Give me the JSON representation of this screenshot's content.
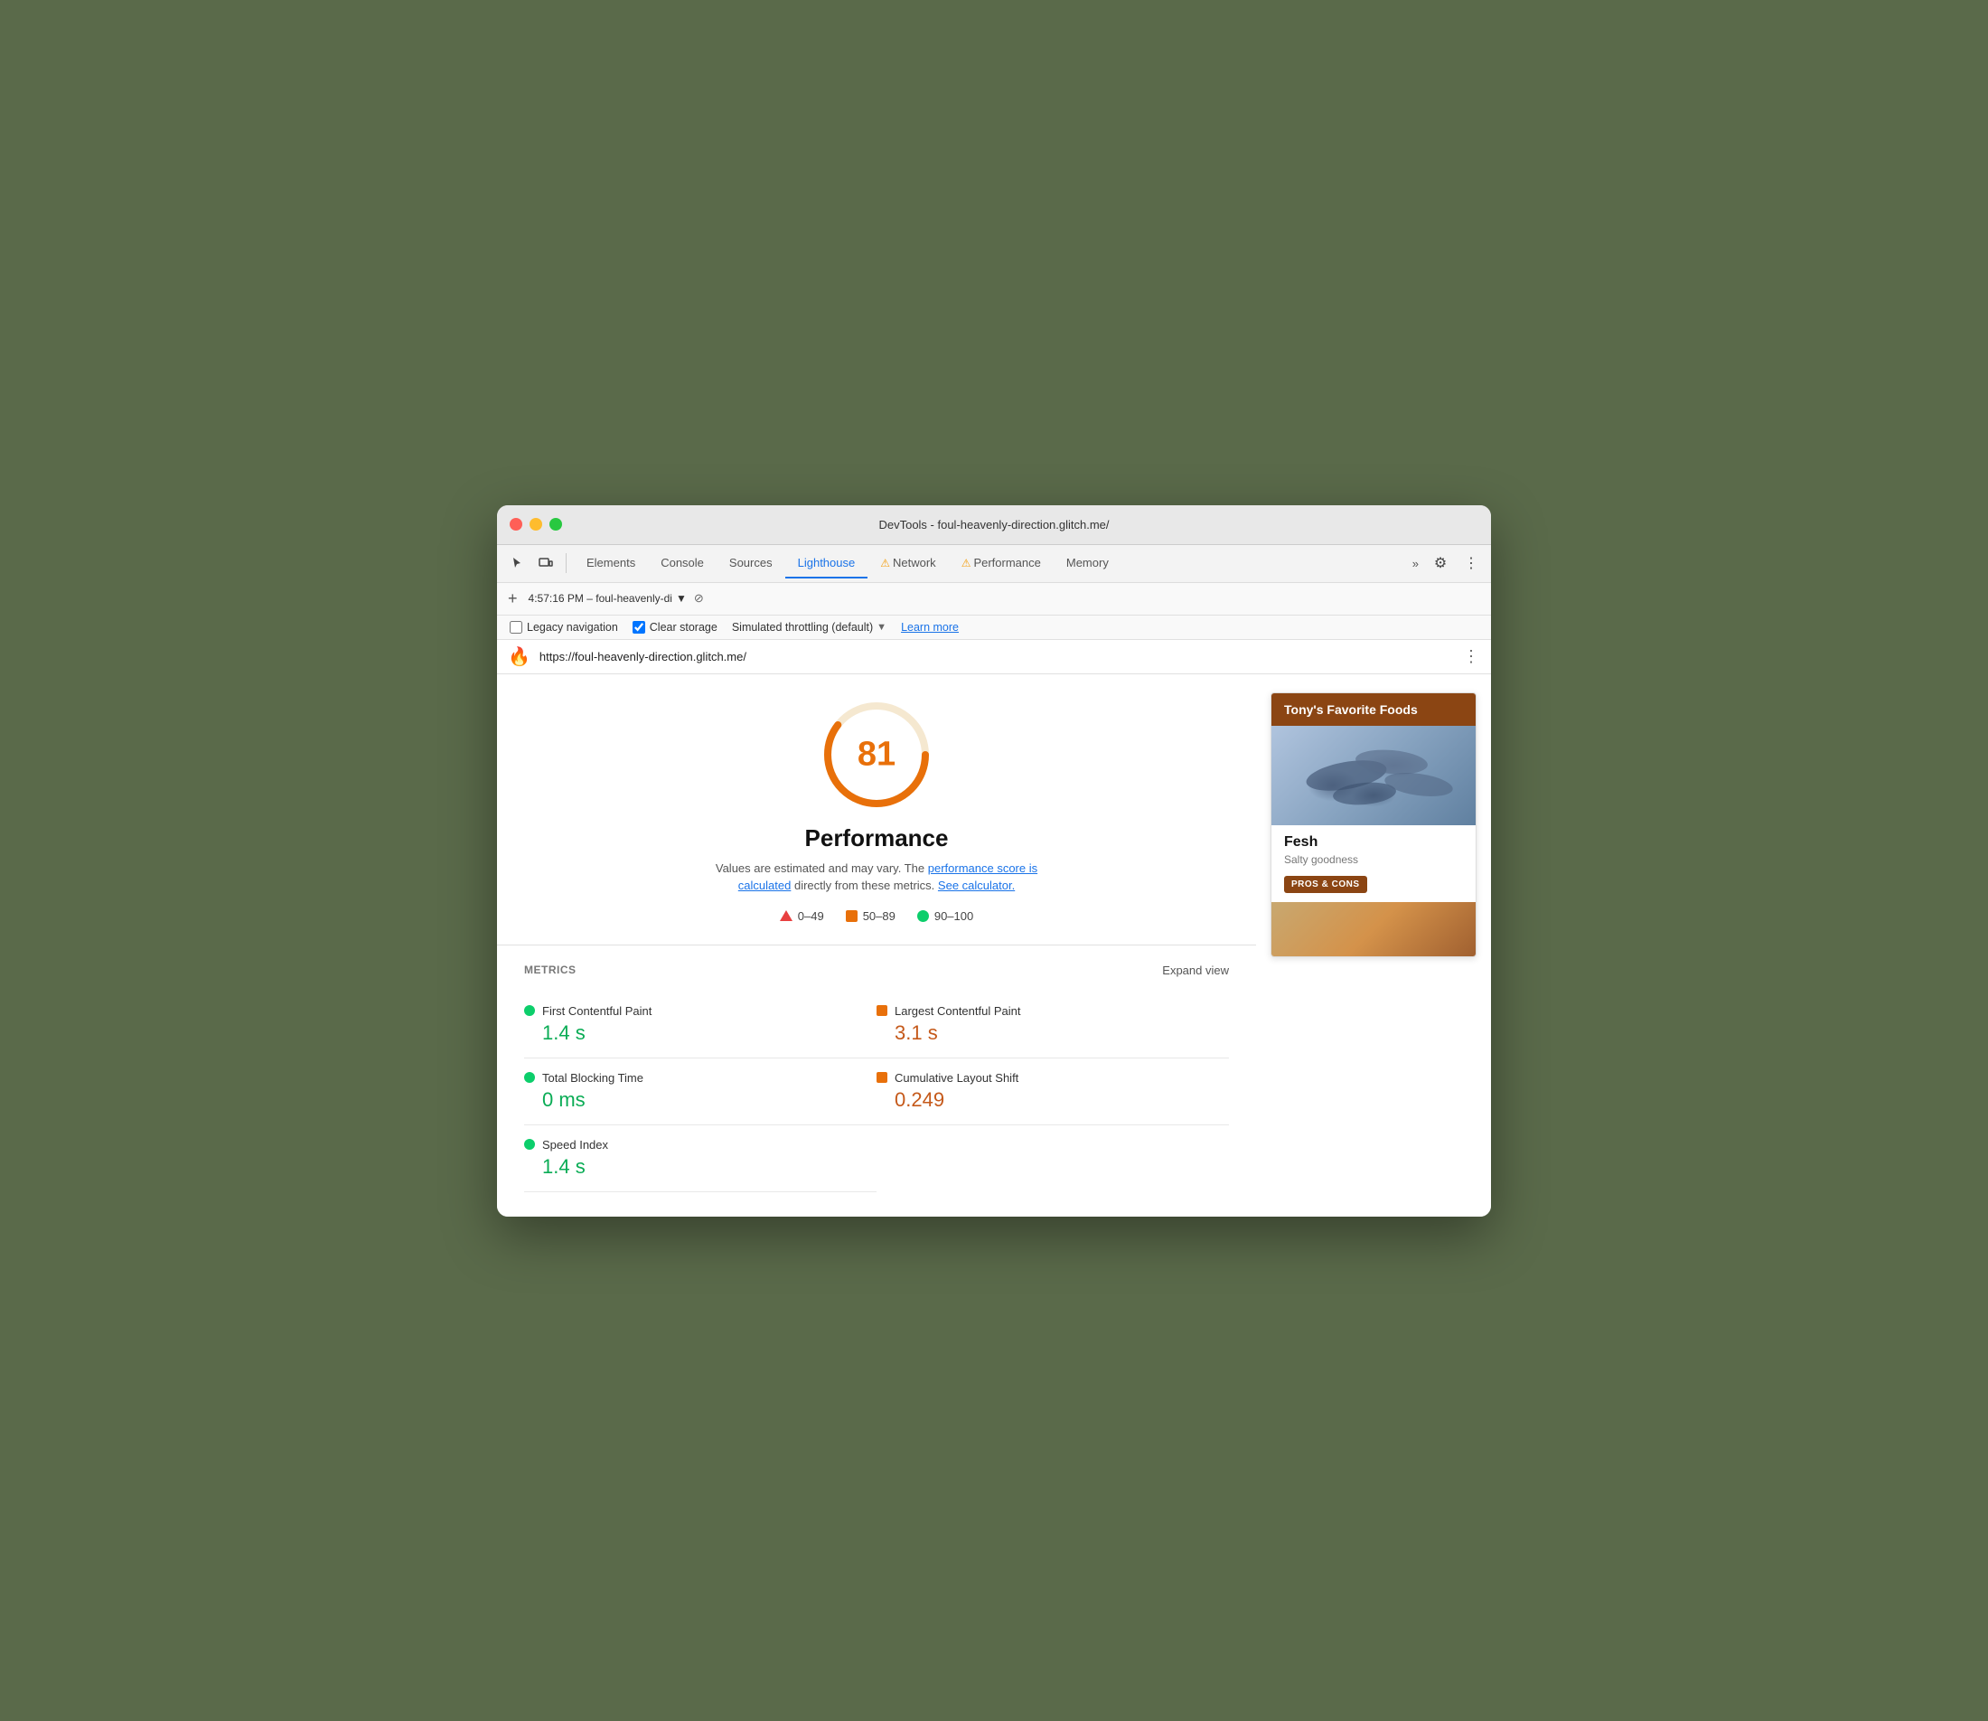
{
  "window": {
    "title": "DevTools - foul-heavenly-direction.glitch.me/"
  },
  "titlebar_buttons": {
    "close": "close",
    "minimize": "minimize",
    "maximize": "maximize"
  },
  "tabs": [
    {
      "label": "Elements",
      "active": false,
      "warning": false
    },
    {
      "label": "Console",
      "active": false,
      "warning": false
    },
    {
      "label": "Sources",
      "active": false,
      "warning": false
    },
    {
      "label": "Lighthouse",
      "active": true,
      "warning": false
    },
    {
      "label": "Network",
      "active": false,
      "warning": true
    },
    {
      "label": "Performance",
      "active": false,
      "warning": true
    },
    {
      "label": "Memory",
      "active": false,
      "warning": false
    }
  ],
  "toolbar": {
    "more_tabs": "»",
    "settings_icon": "⚙",
    "dots_icon": "⋮"
  },
  "session": {
    "label": "4:57:16 PM – foul-heavenly-di",
    "dropdown_arrow": "▼",
    "block_icon": "⊘"
  },
  "options": {
    "legacy_nav_label": "Legacy navigation",
    "legacy_nav_checked": false,
    "clear_storage_label": "Clear storage",
    "clear_storage_checked": true,
    "throttle_label": "Simulated throttling (default)",
    "throttle_arrow": "▼",
    "learn_more": "Learn more"
  },
  "url_bar": {
    "icon": "🔥",
    "url": "https://foul-heavenly-direction.glitch.me/",
    "more": "⋮"
  },
  "score": {
    "value": "81",
    "title": "Performance",
    "desc_static": "Values are estimated and may vary. The",
    "link1": "performance score is calculated",
    "desc_mid": "directly from these metrics.",
    "link2": "See calculator.",
    "ring_color": "#e8700a",
    "ring_bg": "#f0e0c8"
  },
  "legend": [
    {
      "type": "triangle",
      "label": "0–49"
    },
    {
      "type": "square",
      "label": "50–89"
    },
    {
      "type": "circle",
      "label": "90–100"
    }
  ],
  "metrics": {
    "label": "METRICS",
    "expand": "Expand view",
    "items": [
      {
        "name": "First Contentful Paint",
        "value": "1.4 s",
        "indicator": "dot",
        "color": "green",
        "col": 0
      },
      {
        "name": "Largest Contentful Paint",
        "value": "3.1 s",
        "indicator": "sq",
        "color": "orange",
        "col": 1
      },
      {
        "name": "Total Blocking Time",
        "value": "0 ms",
        "indicator": "dot",
        "color": "green",
        "col": 0
      },
      {
        "name": "Cumulative Layout Shift",
        "value": "0.249",
        "indicator": "sq",
        "color": "orange",
        "col": 1
      },
      {
        "name": "Speed Index",
        "value": "1.4 s",
        "indicator": "dot",
        "color": "green",
        "col": 0
      }
    ]
  },
  "preview": {
    "header": "Tony's Favorite Foods",
    "item_title": "Fesh",
    "item_subtitle": "Salty goodness",
    "pros_btn": "PROS & CONS"
  }
}
